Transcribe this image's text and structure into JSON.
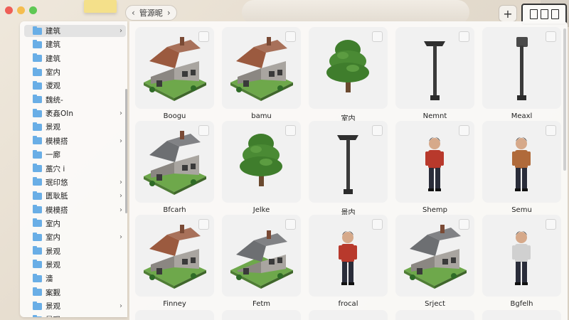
{
  "window": {
    "path_label": "管源昵",
    "back_glyph": "‹",
    "forward_glyph": "›",
    "add_glyph": "+"
  },
  "sidebar": {
    "items": [
      {
        "label": "建筑",
        "chevron": "›",
        "selected": true
      },
      {
        "label": "建筑",
        "chevron": ""
      },
      {
        "label": "建筑",
        "chevron": ""
      },
      {
        "label": "室内",
        "chevron": ""
      },
      {
        "label": "谡观",
        "chevron": ""
      },
      {
        "label": "魏统-",
        "chevron": ""
      },
      {
        "label": "袤姦OIn",
        "chevron": "›"
      },
      {
        "label": "景观",
        "chevron": ""
      },
      {
        "label": "模模搭",
        "chevron": "›"
      },
      {
        "label": "一廊",
        "chevron": ""
      },
      {
        "label": "藁穴 ⅰ",
        "chevron": ""
      },
      {
        "label": "珉印悠",
        "chevron": "›"
      },
      {
        "label": "匮耿胝",
        "chevron": "›"
      },
      {
        "label": "模模搭",
        "chevron": "›"
      },
      {
        "label": "室内",
        "chevron": ""
      },
      {
        "label": "室内",
        "chevron": "›"
      },
      {
        "label": "景观",
        "chevron": ""
      },
      {
        "label": "景观",
        "chevron": ""
      },
      {
        "label": "濇",
        "chevron": ""
      },
      {
        "label": "案觐",
        "chevron": ""
      },
      {
        "label": "景观",
        "chevron": "›"
      },
      {
        "label": "景观",
        "chevron": "›"
      }
    ]
  },
  "grid": {
    "items": [
      {
        "type": "house-brown",
        "caption": "Boogu"
      },
      {
        "type": "house-brown",
        "caption": "bamu"
      },
      {
        "type": "tree",
        "caption": "室内"
      },
      {
        "type": "lamp-double",
        "caption": "Nemnt"
      },
      {
        "type": "lamp-single",
        "caption": "Meaxl"
      },
      {
        "type": "house-gray",
        "caption": "Bfcarh"
      },
      {
        "type": "tree",
        "caption": "Jelke"
      },
      {
        "type": "lamp-double",
        "caption": "景内"
      },
      {
        "type": "person-red",
        "caption": "Shemp"
      },
      {
        "type": "person-brown",
        "caption": "Semu"
      },
      {
        "type": "house-brown",
        "caption": "Finney"
      },
      {
        "type": "house-gray-flat",
        "caption": "Fetm"
      },
      {
        "type": "person-red",
        "caption": "frocal"
      },
      {
        "type": "house-gray",
        "caption": "Srject"
      },
      {
        "type": "person-gray",
        "caption": "Bgfelh"
      }
    ]
  },
  "colors": {
    "folder": "#69aee6",
    "roof_brown": "#9b5a3f",
    "roof_gray": "#6d6f72",
    "grass": "#6ea84b",
    "tree": "#3f7d2c",
    "shirt_red": "#b8392c",
    "shirt_brown": "#b06a3a"
  }
}
